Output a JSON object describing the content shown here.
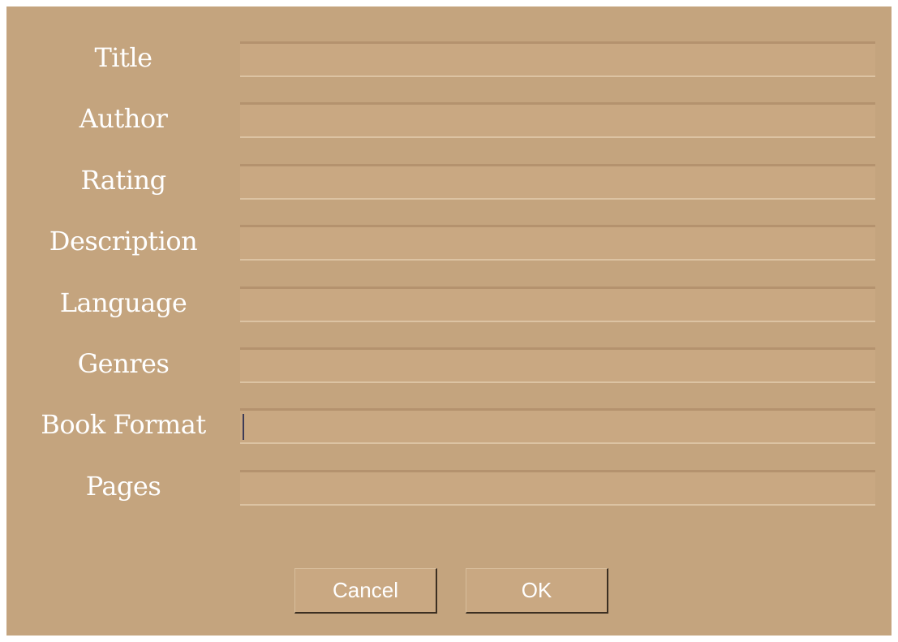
{
  "form": {
    "fields": [
      {
        "label": "Title",
        "value": ""
      },
      {
        "label": "Author",
        "value": ""
      },
      {
        "label": "Rating",
        "value": ""
      },
      {
        "label": "Description",
        "value": ""
      },
      {
        "label": "Language",
        "value": ""
      },
      {
        "label": "Genres",
        "value": ""
      },
      {
        "label": "Book Format",
        "value": ""
      },
      {
        "label": "Pages",
        "value": ""
      }
    ]
  },
  "buttons": {
    "cancel_label": "Cancel",
    "ok_label": "OK"
  },
  "colors": {
    "background": "#c4a47e",
    "field": "#c9a882",
    "label_text": "#ffffff"
  }
}
